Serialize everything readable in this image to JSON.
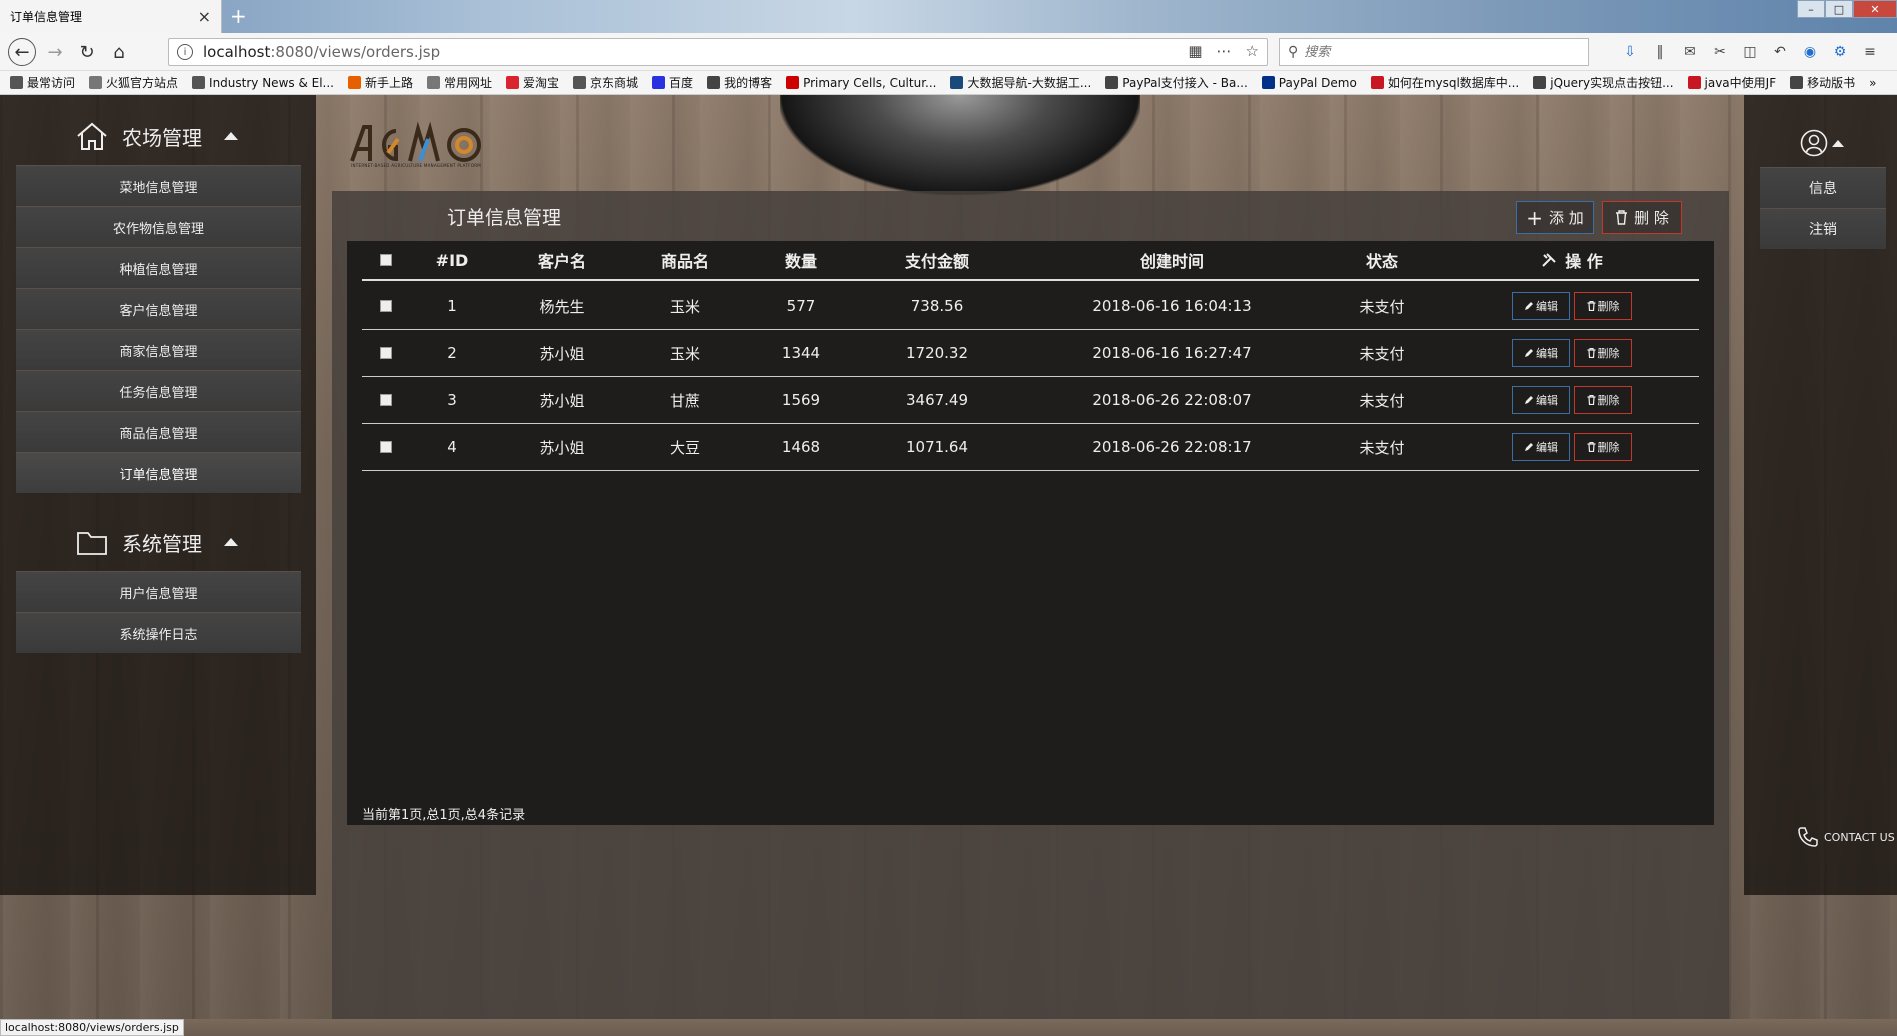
{
  "browser": {
    "tab_title": "订单信息管理",
    "tab_close": "×",
    "new_tab": "+",
    "url_host": "localhost",
    "url_path": ":8080/views/orders.jsp",
    "search_placeholder": "搜索",
    "status_url": "localhost:8080/views/orders.jsp",
    "bookmarks": [
      {
        "label": "最常访问",
        "icon": "gear-icon",
        "color": "#555555"
      },
      {
        "label": "火狐官方站点",
        "icon": "folder-icon",
        "color": "#777777"
      },
      {
        "label": "Industry News & El...",
        "icon": "globe-icon",
        "color": "#555555"
      },
      {
        "label": "新手上路",
        "icon": "firefox-icon",
        "color": "#e66000"
      },
      {
        "label": "常用网址",
        "icon": "folder-icon",
        "color": "#777777"
      },
      {
        "label": "爱淘宝",
        "icon": "taobao-icon",
        "color": "#d9232e"
      },
      {
        "label": "京东商城",
        "icon": "globe-icon",
        "color": "#555555"
      },
      {
        "label": "百度",
        "icon": "baidu-icon",
        "color": "#2932e1"
      },
      {
        "label": "我的博客",
        "icon": "blog-icon",
        "color": "#444444"
      },
      {
        "label": "Primary Cells, Cultur...",
        "icon": "red-dot-icon",
        "color": "#cc0000"
      },
      {
        "label": "大数据导航-大数据工...",
        "icon": "bigdata-icon",
        "color": "#1a4a7a"
      },
      {
        "label": "PayPal支付接入 - Ba...",
        "icon": "blog-icon",
        "color": "#444444"
      },
      {
        "label": "PayPal Demo",
        "icon": "paypal-icon",
        "color": "#003087"
      },
      {
        "label": "如何在mysql数据库中...",
        "icon": "csdn-icon",
        "color": "#c81623"
      },
      {
        "label": "jQuery实现点击按钮...",
        "icon": "blog-icon",
        "color": "#444444"
      },
      {
        "label": "java中使用JF",
        "icon": "csdn-icon",
        "color": "#c81623"
      },
      {
        "label": "移动版书",
        "icon": "mobile-icon",
        "color": "#444444"
      }
    ],
    "more_bookmarks": "»"
  },
  "sidebar": {
    "farm_title": "农场管理",
    "farm_items": [
      {
        "label": "菜地信息管理"
      },
      {
        "label": "农作物信息管理"
      },
      {
        "label": "种植信息管理"
      },
      {
        "label": "客户信息管理"
      },
      {
        "label": "商家信息管理"
      },
      {
        "label": "任务信息管理"
      },
      {
        "label": "商品信息管理"
      },
      {
        "label": "订单信息管理"
      }
    ],
    "system_title": "系统管理",
    "system_items": [
      {
        "label": "用户信息管理"
      },
      {
        "label": "系统操作日志"
      }
    ]
  },
  "logo": {
    "letters": "AGMO",
    "tagline": "INTERNET-BASED AGRICULTURE MANAGEMENT PLATFORM"
  },
  "panel": {
    "title": "订单信息管理",
    "add_label": "添 加",
    "delete_label": "删 除",
    "columns": {
      "id": "#ID",
      "customer": "客户名",
      "product": "商品名",
      "quantity": "数量",
      "amount": "支付金额",
      "created": "创建时间",
      "status": "状态",
      "actions": "操 作"
    },
    "rows": [
      {
        "id": "1",
        "customer": "杨先生",
        "product": "玉米",
        "quantity": "577",
        "amount": "738.56",
        "created": "2018-06-16 16:04:13",
        "status": "未支付"
      },
      {
        "id": "2",
        "customer": "苏小姐",
        "product": "玉米",
        "quantity": "1344",
        "amount": "1720.32",
        "created": "2018-06-16 16:27:47",
        "status": "未支付"
      },
      {
        "id": "3",
        "customer": "苏小姐",
        "product": "甘蔗",
        "quantity": "1569",
        "amount": "3467.49",
        "created": "2018-06-26 22:08:07",
        "status": "未支付"
      },
      {
        "id": "4",
        "customer": "苏小姐",
        "product": "大豆",
        "quantity": "1468",
        "amount": "1071.64",
        "created": "2018-06-26 22:08:17",
        "status": "未支付"
      }
    ],
    "row_edit_label": "编辑",
    "row_delete_label": "删除",
    "pager_text": "当前第1页,总1页,总4条记录"
  },
  "user_menu": {
    "items": [
      {
        "label": "信息"
      },
      {
        "label": "注销"
      }
    ],
    "contact_label": "CONTACT US"
  },
  "colors": {
    "accent_blue": "#3a6ea5",
    "accent_red": "#c0392b"
  }
}
